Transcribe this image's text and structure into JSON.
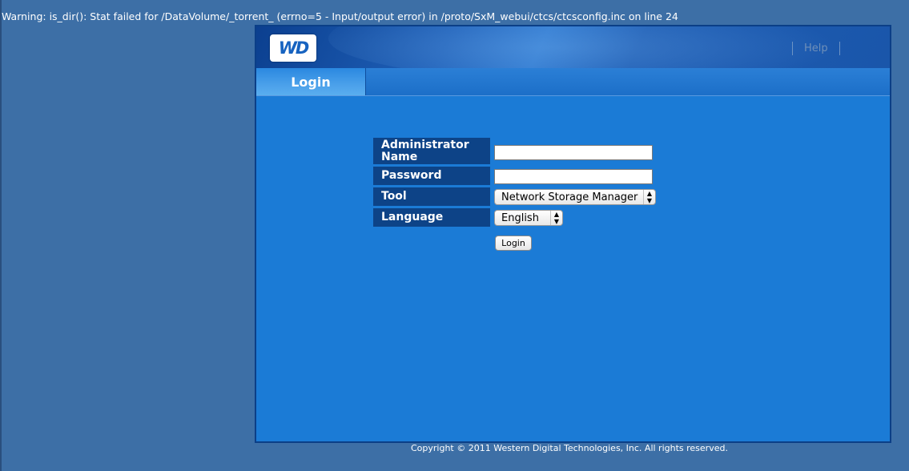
{
  "warning": "Warning: is_dir(): Stat failed for /DataVolume/_torrent_ (errno=5 - Input/output error) in /proto/SxM_webui/ctcs/ctcsconfig.inc on line 24",
  "header": {
    "logo_text": "WD",
    "help_label": "Help"
  },
  "tabs": {
    "login_label": "Login"
  },
  "form": {
    "admin_label": "Administrator Name",
    "admin_value": "",
    "password_label": "Password",
    "password_value": "",
    "tool_label": "Tool",
    "tool_selected": "Network Storage Manager",
    "language_label": "Language",
    "language_selected": "English",
    "login_button": "Login"
  },
  "footer": {
    "copyright": "Copyright © 2011 Western Digital Technologies, Inc. All rights reserved."
  },
  "colors": {
    "page_bg": "#3d6fa6",
    "panel_bg": "#1b7bd6",
    "label_bg": "#0d4387"
  }
}
